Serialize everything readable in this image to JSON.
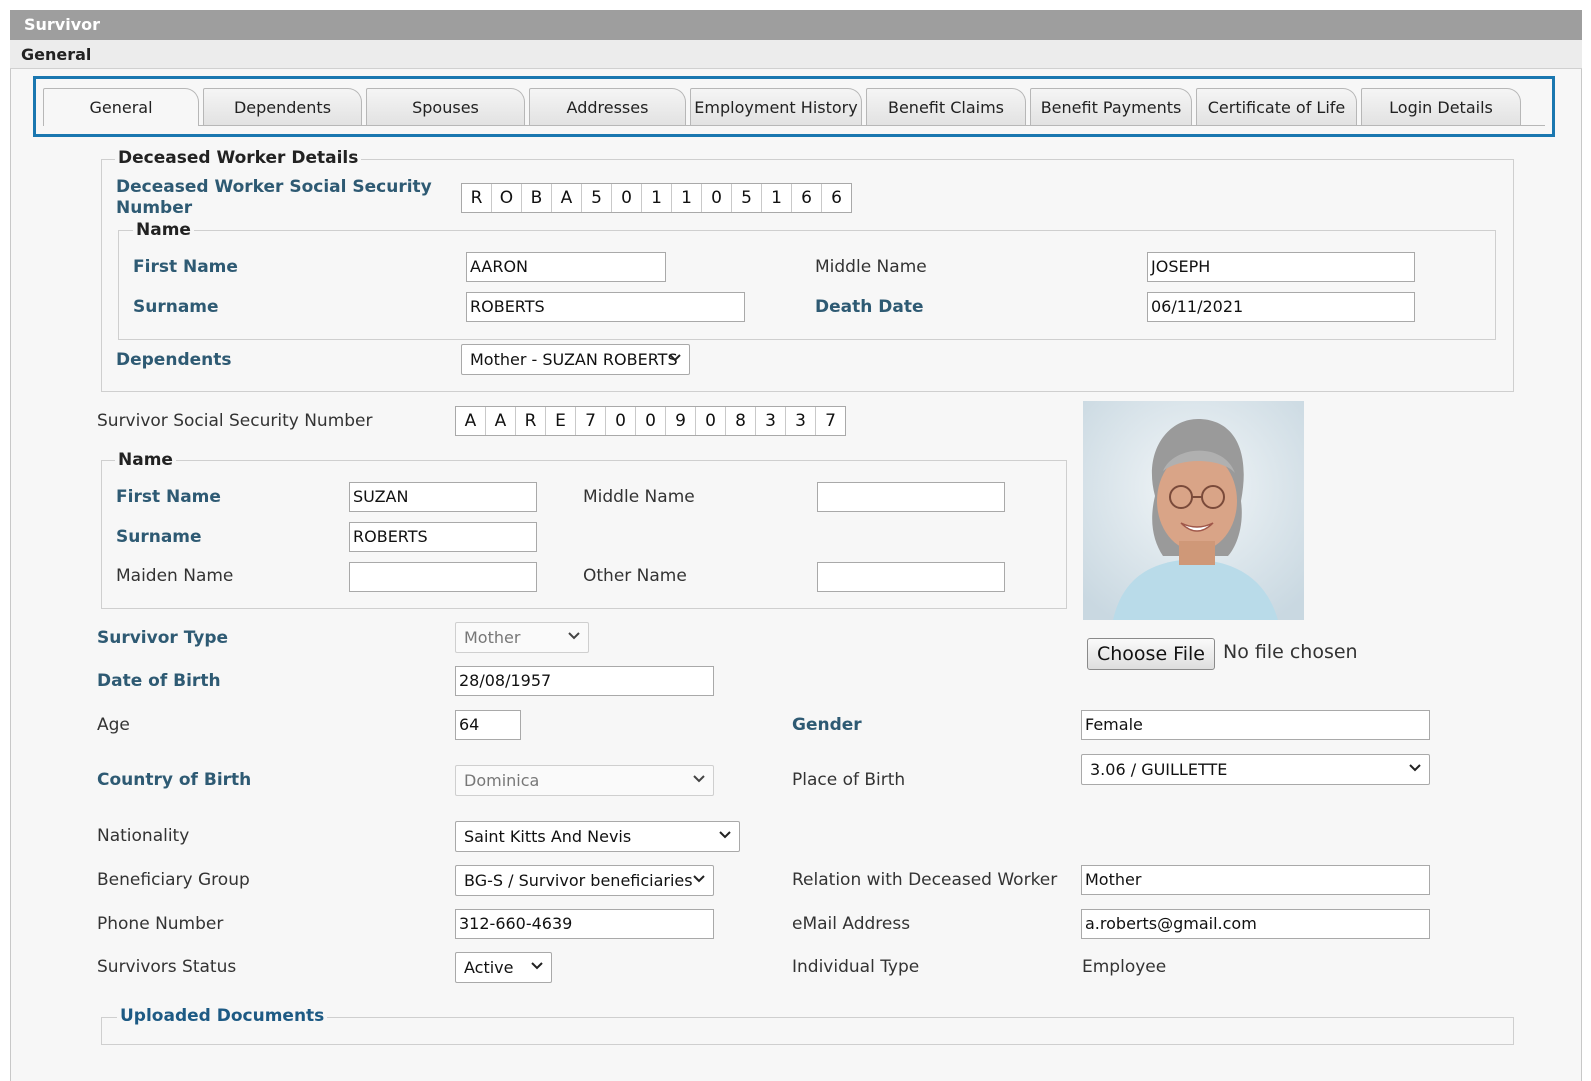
{
  "window": {
    "title": "Survivor",
    "section": "General"
  },
  "tabs": [
    "General",
    "Dependents",
    "Spouses",
    "Addresses",
    "Employment History",
    "Benefit Claims",
    "Benefit Payments",
    "Certificate of Life",
    "Login Details"
  ],
  "deceased": {
    "legend": "Deceased Worker Details",
    "ssn_label_1": "Deceased Worker Social Security",
    "ssn_label_2": "Number",
    "ssn": [
      "R",
      "O",
      "B",
      "A",
      "5",
      "0",
      "1",
      "1",
      "0",
      "5",
      "1",
      "6",
      "6"
    ],
    "name_legend": "Name",
    "first_name_label": "First Name",
    "first_name": "AARON",
    "middle_name_label": "Middle Name",
    "middle_name": "JOSEPH",
    "surname_label": "Surname",
    "surname": "ROBERTS",
    "death_date_label": "Death Date",
    "death_date": "06/11/2021",
    "dependents_label": "Dependents",
    "dependents_selected": "Mother - SUZAN ROBERTS"
  },
  "survivor": {
    "ssn_label": "Survivor Social Security Number",
    "ssn": [
      "A",
      "A",
      "R",
      "E",
      "7",
      "0",
      "0",
      "9",
      "0",
      "8",
      "3",
      "3",
      "7"
    ],
    "name_legend": "Name",
    "first_name_label": "First Name",
    "first_name": "SUZAN",
    "middle_name_label": "Middle Name",
    "middle_name": "",
    "surname_label": "Surname",
    "surname": "ROBERTS",
    "maiden_name_label": "Maiden Name",
    "maiden_name": "",
    "other_name_label": "Other Name",
    "other_name": "",
    "type_label": "Survivor Type",
    "type": "Mother",
    "dob_label": "Date of Birth",
    "dob": "28/08/1957",
    "age_label": "Age",
    "age": "64",
    "gender_label": "Gender",
    "gender": "Female",
    "country_label": "Country of Birth",
    "country": "Dominica",
    "place_label": "Place of Birth",
    "place": "3.06 / GUILLETTE",
    "nationality_label": "Nationality",
    "nationality": "Saint Kitts And Nevis",
    "beneficiary_label": "Beneficiary Group",
    "beneficiary": "BG-S / Survivor beneficiaries",
    "relation_label": "Relation with Deceased Worker",
    "relation": "Mother",
    "phone_label": "Phone Number",
    "phone": "312-660-4639",
    "email_label": "eMail Address",
    "email": "a.roberts@gmail.com",
    "status_label": "Survivors Status",
    "status": "Active",
    "individual_type_label": "Individual Type",
    "individual_type": "Employee"
  },
  "photo": {
    "choose_file": "Choose File",
    "no_file": "No file chosen"
  },
  "documents": {
    "legend": "Uploaded Documents"
  },
  "colors": {
    "accent": "#1a77b0",
    "required_label": "#2e5a73",
    "titlebar": "#9e9e9e"
  }
}
